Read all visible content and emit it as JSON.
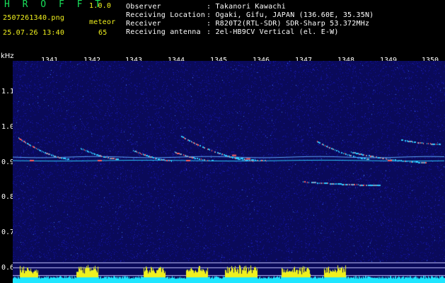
{
  "header": {
    "logo": "H R O F F T",
    "version": "1.0.0",
    "filename": "2507261340.png",
    "timestamp": "25.07.26 13:40",
    "meteor_label": "meteor",
    "meteor_count": "65",
    "rows": [
      {
        "label": "Observer",
        "value": ": Takanori Kawachi"
      },
      {
        "label": "Receiving Location",
        "value": ": Ogaki, Gifu, JAPAN (136.60E, 35.35N)"
      },
      {
        "label": "Receiver",
        "value": ": R820T2(RTL-SDR) SDR-Sharp 53.372MHz"
      },
      {
        "label": "Receiving antenna",
        "value": ": 2el-HB9CV Vertical (el. E-W)"
      }
    ]
  },
  "axis": {
    "unit": "kHz",
    "y_ticks": [
      "1.1",
      "1.0",
      "0.9",
      "0.8",
      "0.7",
      "0.6"
    ],
    "x_ticks": [
      "1341",
      "1342",
      "1343",
      "1344",
      "1345",
      "1346",
      "1347",
      "1348",
      "1349",
      "1350"
    ]
  },
  "colors": {
    "background": "#0a0a5a",
    "noise_dark": "#1414a0",
    "carrier": "#2ec8ff",
    "hot": "#ff6060",
    "level_fill": "#1ee6ff",
    "level_peak": "#f0f01e"
  }
}
